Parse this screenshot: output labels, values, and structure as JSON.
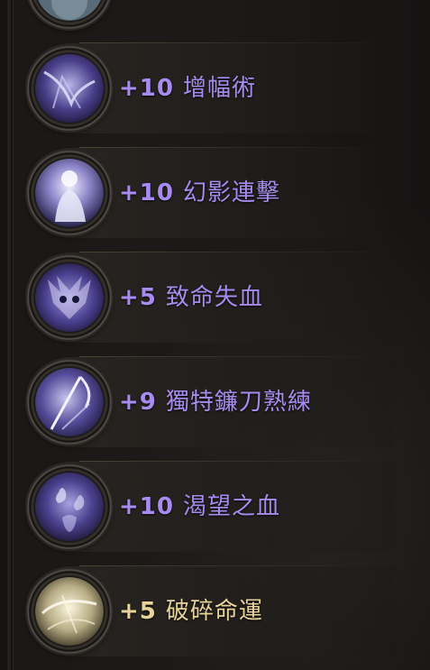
{
  "colors": {
    "purple_text": "#a88bf0",
    "gold_text": "#e8d49a",
    "panel_bg": "#1b1917"
  },
  "skills": [
    {
      "level": "+10",
      "name": "增幅術",
      "icon": "amplify-icon",
      "tint": "purple"
    },
    {
      "level": "+10",
      "name": "幻影連擊",
      "icon": "phantom-strike-icon",
      "tint": "purple"
    },
    {
      "level": "+5",
      "name": "致命失血",
      "icon": "fatal-bleed-icon",
      "tint": "purple"
    },
    {
      "level": "+9",
      "name": "獨特鐮刀熟練",
      "icon": "scythe-mastery-icon",
      "tint": "purple"
    },
    {
      "level": "+10",
      "name": "渴望之血",
      "icon": "blood-thirst-icon",
      "tint": "purple"
    },
    {
      "level": "+5",
      "name": "破碎命運",
      "icon": "shattered-fate-icon",
      "tint": "gold"
    }
  ]
}
